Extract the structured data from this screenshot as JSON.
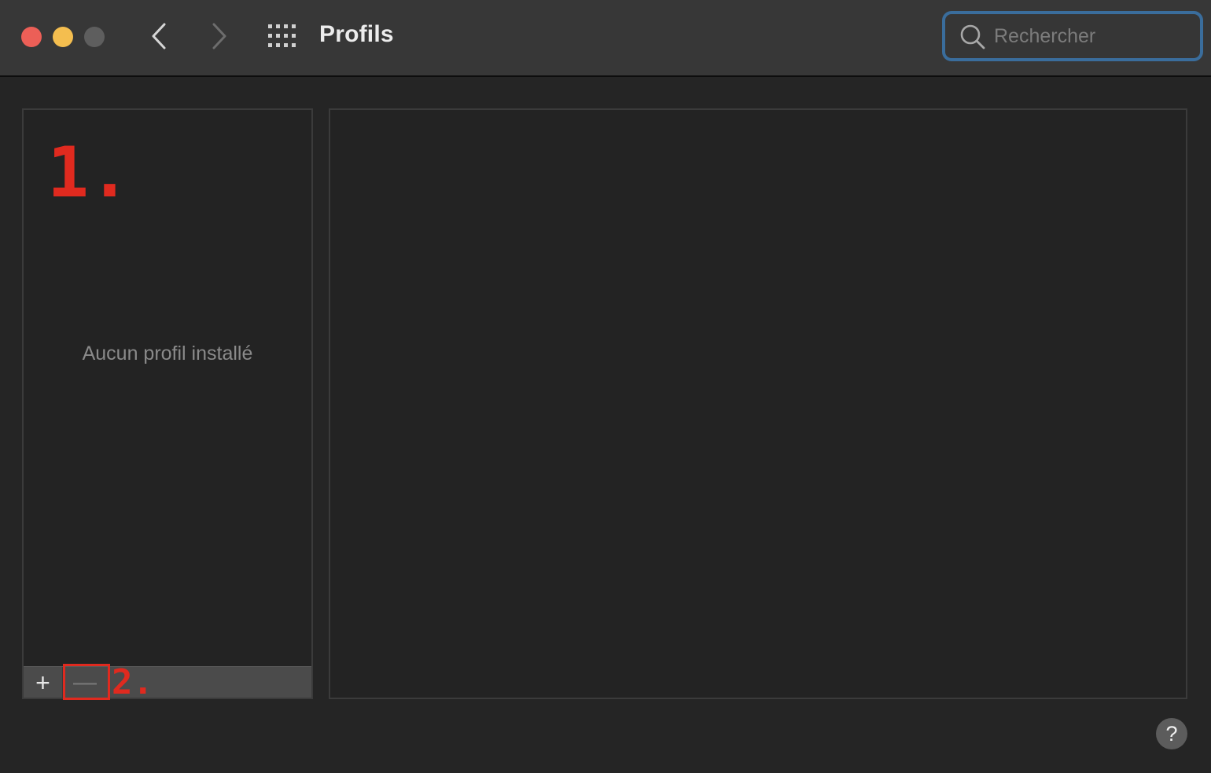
{
  "window": {
    "title": "Profils"
  },
  "toolbar": {
    "back_icon": "chevron-left-icon",
    "forward_icon": "chevron-right-icon",
    "grid_icon": "show-all-grid-icon"
  },
  "search": {
    "placeholder": "Rechercher",
    "value": ""
  },
  "profiles_list": {
    "empty_message": "Aucun profil installé",
    "items": [],
    "add_label": "+",
    "remove_label": "—"
  },
  "annotations": {
    "step_1": "1.",
    "step_2": "2."
  },
  "help": {
    "label": "?"
  },
  "colors": {
    "close": "#ec5f57",
    "minimize": "#f4be4f",
    "zoom": "#5e5e5e",
    "search_focus": "#3a6d9c",
    "annotation": "#e02a1f"
  }
}
